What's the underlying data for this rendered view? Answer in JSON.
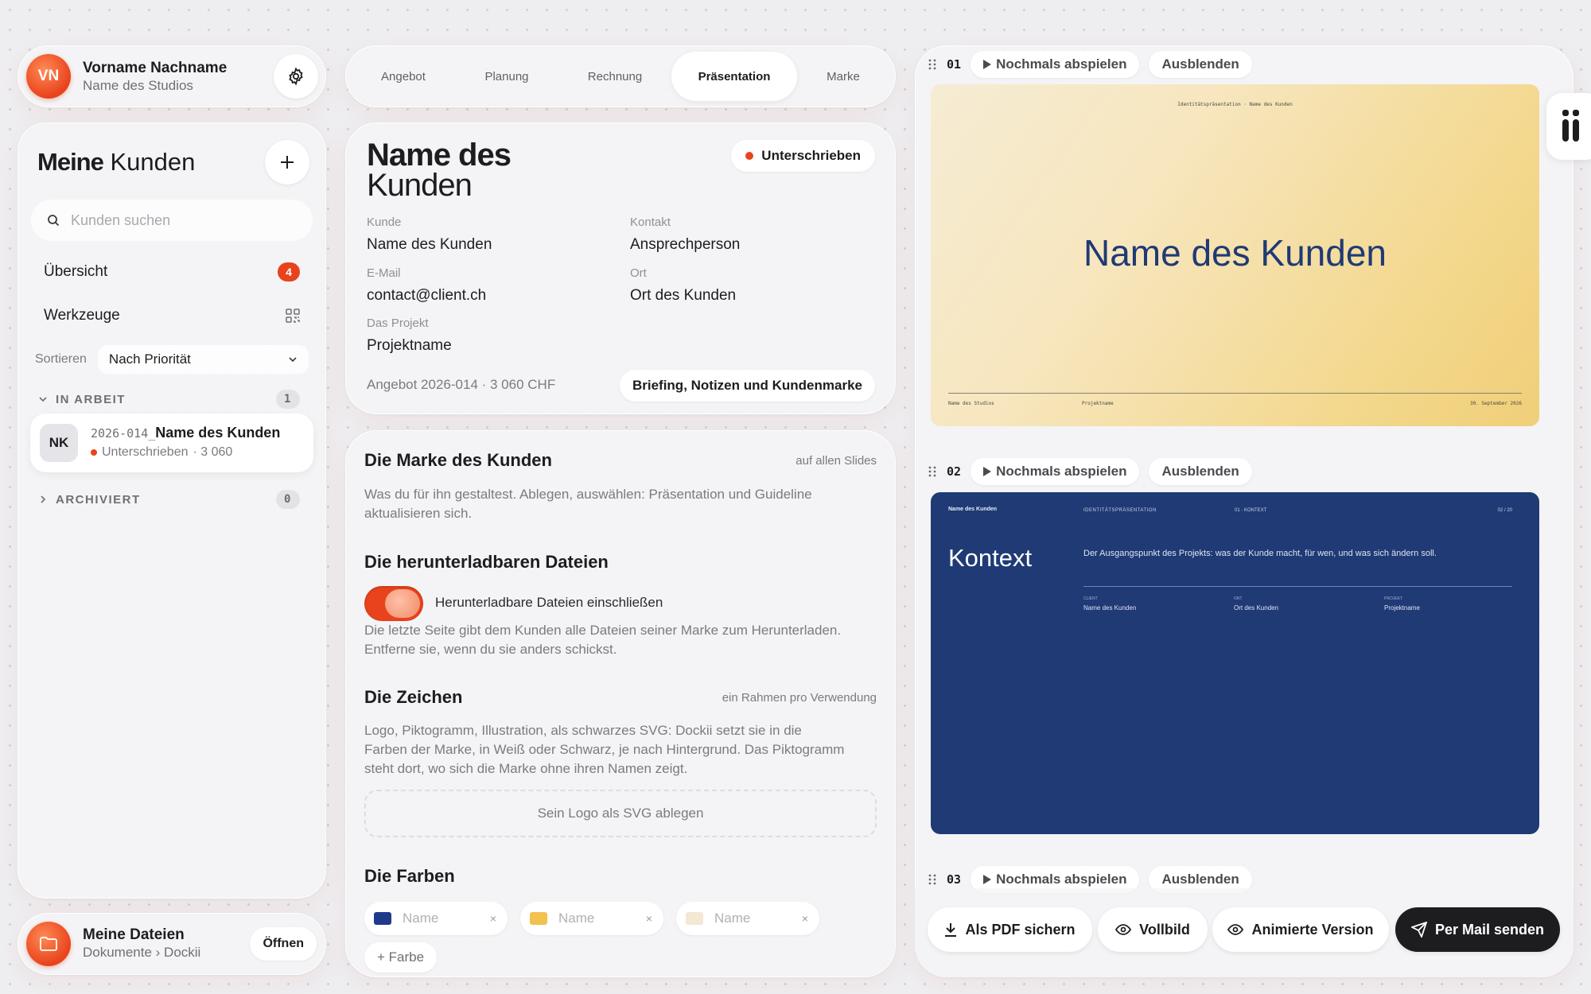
{
  "profile": {
    "initials": "VN",
    "name": "Vorname Nachname",
    "studio": "Name des Studios"
  },
  "sidebar": {
    "title_bold": "Meine",
    "title_rest": " Kunden",
    "search_placeholder": "Kunden suchen",
    "overview_label": "Übersicht",
    "overview_count": "4",
    "tools_label": "Werkzeuge",
    "sort_label": "Sortieren",
    "sort_value": "Nach Priorität",
    "in_progress_label": "IN ARBEIT",
    "in_progress_count": "1",
    "archived_label": "ARCHIVIERT",
    "archived_count": "0",
    "client_item": {
      "initials": "NK",
      "number": "2026-014_",
      "name": "Name des Kunden",
      "status": "Unterschrieben",
      "amount": "· 3 060"
    }
  },
  "files": {
    "title": "Meine Dateien",
    "path": "Dokumente › Dockii",
    "open_label": "Öffnen"
  },
  "tabs": [
    {
      "label": "Angebot"
    },
    {
      "label": "Planung"
    },
    {
      "label": "Rechnung"
    },
    {
      "label": "Präsentation"
    },
    {
      "label": "Marke"
    }
  ],
  "client": {
    "name_line1": "Name des",
    "name_line2": "Kunden",
    "status_label": "Unterschrieben",
    "fields": {
      "kunde_label": "Kunde",
      "kunde_value": "Name des Kunden",
      "kontakt_label": "Kontakt",
      "kontakt_value": "Ansprechperson",
      "email_label": "E-Mail",
      "email_value": "contact@client.ch",
      "ort_label": "Ort",
      "ort_value": "Ort des Kunden",
      "projekt_label": "Das Projekt",
      "projekt_value": "Projektname"
    },
    "offer_info": "Angebot 2026-014 · 3 060 CHF",
    "briefing_button": "Briefing, Notizen und Kundenmarke"
  },
  "brand": {
    "title": "Die Marke des Kunden",
    "hint": "auf allen Slides",
    "desc": "Was du für ihn gestaltest. Ablegen, auswählen: Präsentation und Guideline aktualisieren sich.",
    "downloads_title": "Die herunterladbaren Dateien",
    "toggle_label": "Herunterladbare Dateien einschließen",
    "downloads_desc": "Die letzte Seite gibt dem Kunden alle Dateien seiner Marke zum Herunterladen. Entferne sie, wenn du sie anders schickst.",
    "signs_title": "Die Zeichen",
    "signs_hint": "ein Rahmen pro Verwendung",
    "signs_desc": "Logo, Piktogramm, Illustration, als schwarzes SVG: Dockii setzt sie in die Farben der Marke, in Weiß oder Schwarz, je nach Hintergrund. Das Piktogramm steht dort, wo sich die Marke ohne ihren Namen zeigt.",
    "drop_label": "Sein Logo als SVG ablegen",
    "colors_title": "Die Farben",
    "color_chips": [
      {
        "placeholder": "Name",
        "color": "#1f3a8a"
      },
      {
        "placeholder": "Name",
        "color": "#f2c14e"
      },
      {
        "placeholder": "Name",
        "color": "#f4e7d4"
      }
    ],
    "add_color": "+ Farbe"
  },
  "slides": {
    "replay_label": "Nochmals abspielen",
    "hide_label": "Ausblenden",
    "slide1": {
      "num": "01",
      "header": "Identitätspräsentation · Name des Kunden",
      "title": "Name des Kunden",
      "footer_left": "Name des Studios",
      "footer_mid": "Projektname",
      "footer_right": "30. September 2026"
    },
    "slide2": {
      "num": "02",
      "top_client": "Name des Kunden",
      "top_section": "IDENTITÄTSPRÄSENTATION",
      "top_chapter": "01 · KONTEXT",
      "top_page": "02 / 20",
      "title": "Kontext",
      "text": "Der Ausgangspunkt des Projekts: was der Kunde macht, für wen, und was sich ändern soll.",
      "meta_client_label": "CLIENT",
      "meta_client_value": "Name des Kunden",
      "meta_ort_label": "ORT",
      "meta_ort_value": "Ort des Kunden",
      "meta_projekt_label": "PROJEKT",
      "meta_projekt_value": "Projektname"
    },
    "slide3": {
      "num": "03"
    }
  },
  "actions": {
    "pdf": "Als PDF sichern",
    "fullscreen": "Vollbild",
    "animated": "Animierte Version",
    "mail": "Per Mail senden"
  },
  "colors": {
    "accent": "#e8431c",
    "navy": "#1f3a75",
    "dark": "#1d1d1f"
  }
}
